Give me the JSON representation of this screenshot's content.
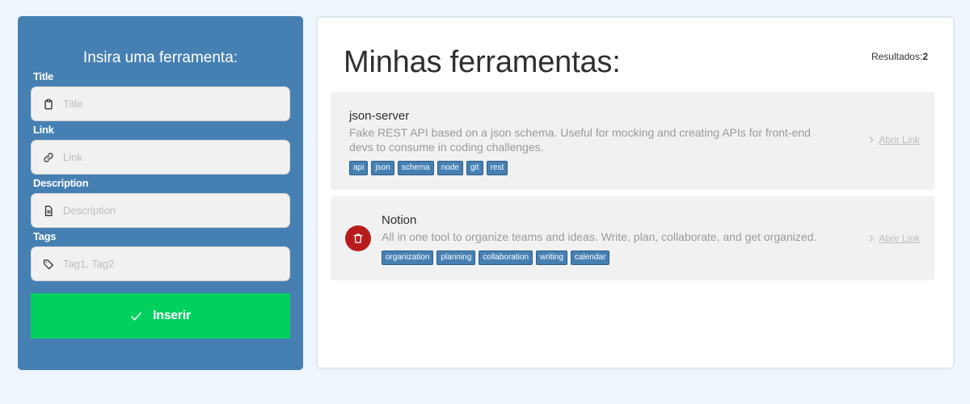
{
  "form": {
    "title": "Insira uma ferramenta:",
    "fields": [
      {
        "label": "Title",
        "placeholder": "Title",
        "icon": "clipboard-icon"
      },
      {
        "label": "Link",
        "placeholder": "Link",
        "icon": "link-icon"
      },
      {
        "label": "Description",
        "placeholder": "Description",
        "icon": "document-icon"
      },
      {
        "label": "Tags",
        "placeholder": "Tag1, Tag2",
        "icon": "tag-icon"
      }
    ],
    "submit_label": "Inserir",
    "submit_icon": "check-icon"
  },
  "tools": {
    "title": "Minhas ferramentas:",
    "results_label": "Resultados:",
    "results_count": "2",
    "items": [
      {
        "name": "json-server",
        "description": "Fake REST API based on a json schema. Useful for mocking and creating APIs for front-end devs to consume in coding challenges.",
        "tags": [
          "api",
          "json",
          "schema",
          "node",
          "git",
          "rest"
        ],
        "link_label": "Abrir Link",
        "deletable": false
      },
      {
        "name": "Notion",
        "description": "All in one tool to organize teams and ideas. Write, plan, collaborate, and get organized.",
        "tags": [
          "organization",
          "planning",
          "collaboration",
          "writing",
          "calendar"
        ],
        "link_label": "Abrir Link",
        "deletable": true
      }
    ]
  },
  "colors": {
    "background": "#eef5fc",
    "form_panel": "#4680b3",
    "submit_button": "#00d15e",
    "tag": "#4680b3",
    "delete_button": "#b71c1c",
    "card": "#f1f1f1"
  }
}
